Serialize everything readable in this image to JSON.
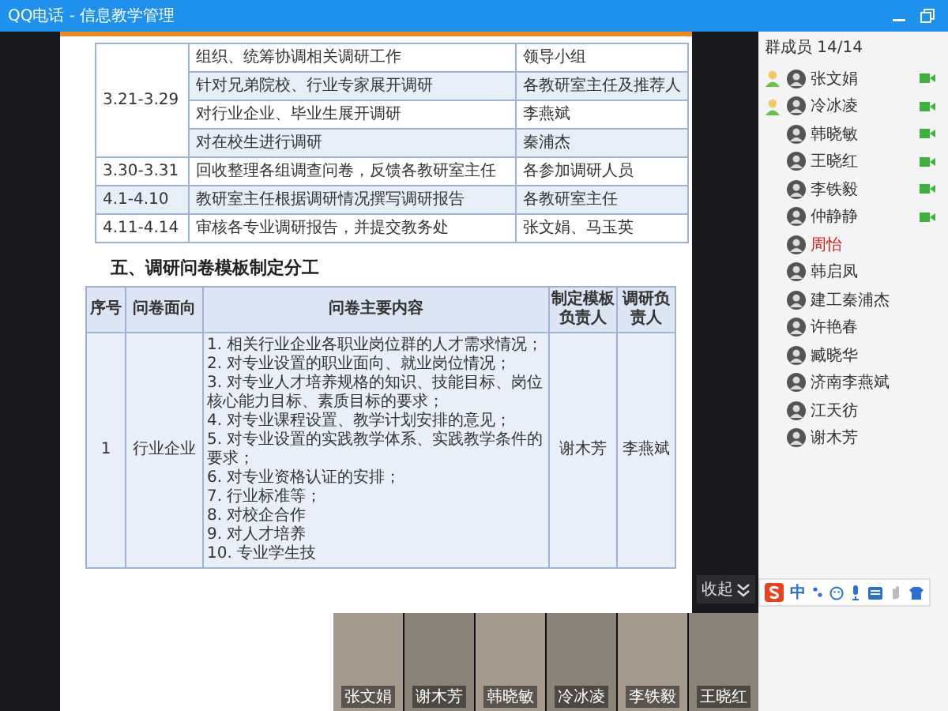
{
  "window": {
    "title": "QQ电话 - 信息教学管理"
  },
  "schedule": [
    {
      "date": "3.21-3.29",
      "tasks": [
        {
          "task": "组织、统筹协调相关调研工作",
          "owner": "领导小组",
          "highlighted": false
        },
        {
          "task": "针对兄弟院校、行业专家展开调研",
          "owner": "各教研室主任及推荐人",
          "highlighted": true
        },
        {
          "task": "对行业企业、毕业生展开调研",
          "owner": "李燕斌",
          "highlighted": false
        },
        {
          "task": "对在校生进行调研",
          "owner": "秦浦杰",
          "highlighted": true
        }
      ]
    },
    {
      "date": "3.30-3.31",
      "tasks": [
        {
          "task": "回收整理各组调查问卷，反馈各教研室主任",
          "owner": "各参加调研人员",
          "highlighted": false
        }
      ]
    },
    {
      "date": "4.1-4.10",
      "tasks": [
        {
          "task": "教研室主任根据调研情况撰写调研报告",
          "owner": "各教研室主任",
          "highlighted": true
        }
      ]
    },
    {
      "date": "4.11-4.14",
      "tasks": [
        {
          "task": "审核各专业调研报告，并提交教务处",
          "owner": "张文娟、马玉英",
          "highlighted": false
        }
      ]
    }
  ],
  "section_heading": "五、调研问卷模板制定分工",
  "survey_table": {
    "columns": [
      "序号",
      "问卷面向",
      "问卷主要内容",
      "制定模板负责人",
      "调研负责人"
    ],
    "rows": [
      {
        "number": "1",
        "audience": "行业企业",
        "items": [
          "1. 相关行业企业各职业岗位群的人才需求情况；",
          "2. 对专业设置的职业面向、就业岗位情况；",
          "3. 对专业人才培养规格的知识、技能目标、岗位核心能力目标、素质目标的要求；",
          "4. 对专业课程设置、教学计划安排的意见；",
          "5. 对专业设置的实践教学体系、实践教学条件的要求；",
          "6. 对专业资格认证的安排；",
          "7. 行业标准等；",
          "8. 对校企合作",
          "9. 对人才培养",
          "10. 专业学生技"
        ],
        "template_owner": "谢木芳",
        "survey_owner": "李燕斌"
      }
    ]
  },
  "videos": [
    {
      "name": "张文娟"
    },
    {
      "name": "谢木芳"
    },
    {
      "name": "韩晓敏"
    },
    {
      "name": "冷冰凌"
    },
    {
      "name": "李铁毅"
    },
    {
      "name": "王晓红"
    }
  ],
  "collapse_label": "收起",
  "members": {
    "header": "群成员 14/14",
    "items": [
      {
        "name": "张文娟",
        "admin": true,
        "video": true,
        "highlighted": false
      },
      {
        "name": "冷冰凌",
        "admin": true,
        "video": true,
        "highlighted": false
      },
      {
        "name": "韩晓敏",
        "admin": false,
        "video": true,
        "highlighted": false
      },
      {
        "name": "王晓红",
        "admin": false,
        "video": true,
        "highlighted": false
      },
      {
        "name": "李铁毅",
        "admin": false,
        "video": true,
        "highlighted": false
      },
      {
        "name": "仲静静",
        "admin": false,
        "video": true,
        "highlighted": false
      },
      {
        "name": "周怡",
        "admin": false,
        "video": false,
        "highlighted": true
      },
      {
        "name": "韩启凤",
        "admin": false,
        "video": false,
        "highlighted": false
      },
      {
        "name": "建工秦浦杰",
        "admin": false,
        "video": false,
        "highlighted": false
      },
      {
        "name": "许艳春",
        "admin": false,
        "video": false,
        "highlighted": false
      },
      {
        "name": "臧晓华",
        "admin": false,
        "video": false,
        "highlighted": false
      },
      {
        "name": "济南李燕斌",
        "admin": false,
        "video": false,
        "highlighted": false
      },
      {
        "name": "江天彷",
        "admin": false,
        "video": false,
        "highlighted": false
      },
      {
        "name": "谢木芳",
        "admin": false,
        "video": false,
        "highlighted": false
      }
    ]
  },
  "ime": {
    "mode": "中"
  }
}
